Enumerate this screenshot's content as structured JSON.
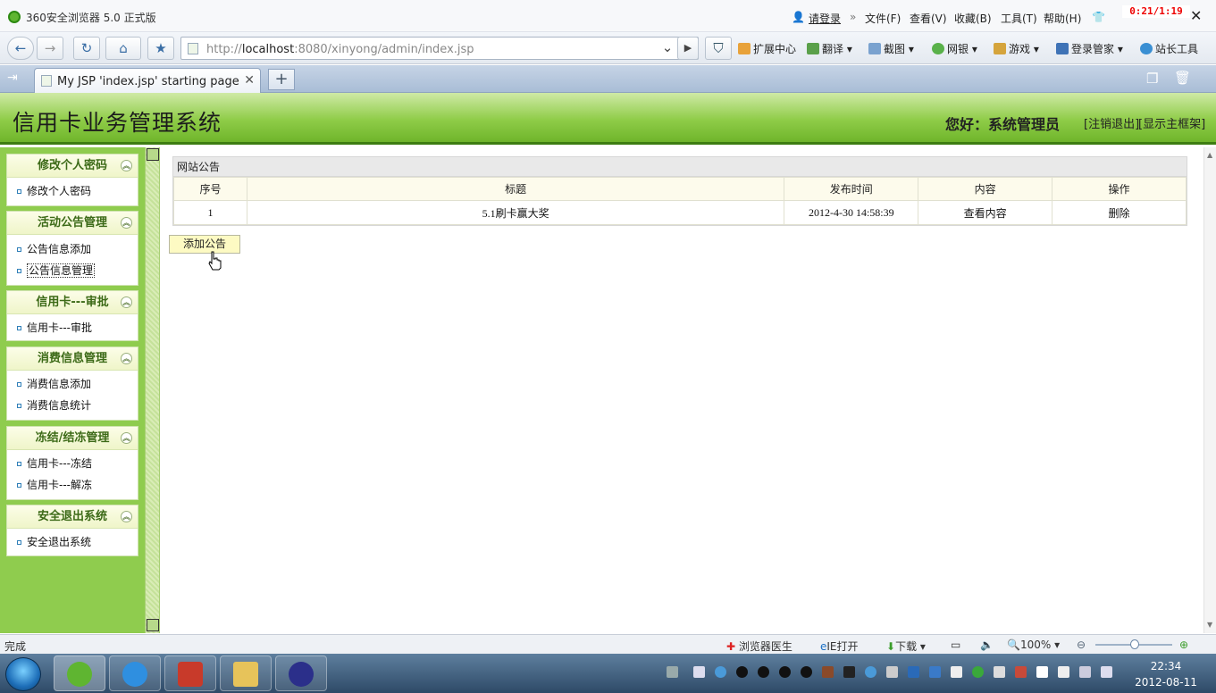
{
  "browser": {
    "title": "360安全浏览器 5.0 正式版",
    "login": "请登录",
    "menus": [
      "文件(F)",
      "查看(V)",
      "收藏(B)",
      "工具(T)",
      "帮助(H)"
    ],
    "clock": "0:21/1:19",
    "url_prefix": "http://",
    "url_host": "localhost",
    "url_rest": ":8080/xinyong/admin/index.jsp",
    "tools": [
      "扩展中心",
      "翻译",
      "截图",
      "网银",
      "游戏",
      "登录管家",
      "站长工具"
    ],
    "tab_title": "My JSP 'index.jsp' starting page",
    "status_left": "完成",
    "status_items": [
      "浏览器医生",
      "IE打开",
      "下载"
    ],
    "zoom": "100%"
  },
  "header": {
    "title": "信用卡业务管理系统",
    "greeting": "您好：系统管理员",
    "logout": "[注销退出]",
    "show_frame": "[显示主框架]"
  },
  "sidebar": [
    {
      "title": "修改个人密码",
      "items": [
        "修改个人密码"
      ]
    },
    {
      "title": "活动公告管理",
      "items": [
        "公告信息添加",
        "公告信息管理"
      ]
    },
    {
      "title": "信用卡---审批",
      "items": [
        "信用卡---审批"
      ]
    },
    {
      "title": "消费信息管理",
      "items": [
        "消费信息添加",
        "消费信息统计"
      ]
    },
    {
      "title": "冻结/结冻管理",
      "items": [
        "信用卡---冻结",
        "信用卡---解冻"
      ]
    },
    {
      "title": "安全退出系统",
      "items": [
        "安全退出系统"
      ]
    }
  ],
  "notice": {
    "caption": "网站公告",
    "columns": [
      "序号",
      "标题",
      "发布时间",
      "内容",
      "操作"
    ],
    "rows": [
      {
        "no": "1",
        "title": "5.1刷卡赢大奖",
        "time": "2012-4-30 14:58:39",
        "content": "查看内容",
        "op": "删除"
      }
    ],
    "add_button": "添加公告"
  },
  "taskbar": {
    "time": "22:34",
    "date": "2012-08-11"
  }
}
